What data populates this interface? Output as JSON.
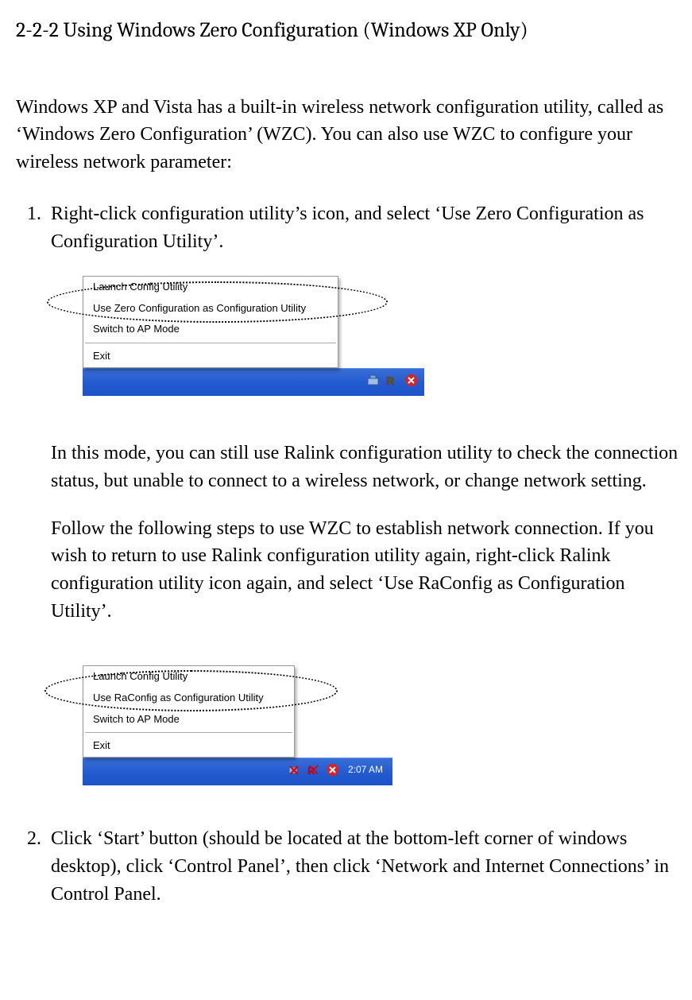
{
  "heading": "2-2-2 Using Windows Zero Configuration (Windows XP Only)",
  "intro": "Windows XP and Vista has a built-in wireless network configuration utility, called as ‘Windows Zero Configuration’ (WZC). You can also use WZC to configure your wireless network parameter:",
  "step1": {
    "text": "Right-click configuration utility’s icon, and select ‘Use Zero Configuration as Configuration Utility’.",
    "menu": {
      "item1": "Launch Config Utility",
      "item2": "Use Zero Configuration as Configuration Utility",
      "item3": "Switch to AP Mode",
      "item4": "Exit"
    },
    "para1": "In this mode, you can still use Ralink configuration utility to check the connection status, but unable to connect to a wireless network, or change network setting.",
    "para2": "Follow the following steps to use WZC to establish network connection. If you wish to return to use Ralink configuration utility again, right-click Ralink configuration utility icon again, and select ‘Use RaConfig as Configuration Utility’.",
    "menu2": {
      "item1": "Launch Config Utility",
      "item2": "Use RaConfig as Configuration Utility",
      "item3": "Switch to AP Mode",
      "item4": "Exit"
    },
    "clock": "2:07 AM"
  },
  "step2": {
    "text": "Click ‘Start’ button (should be located at the bottom-left corner of windows desktop), click ‘Control Panel’, then click ‘Network and Internet Connections’ in Control Panel."
  }
}
